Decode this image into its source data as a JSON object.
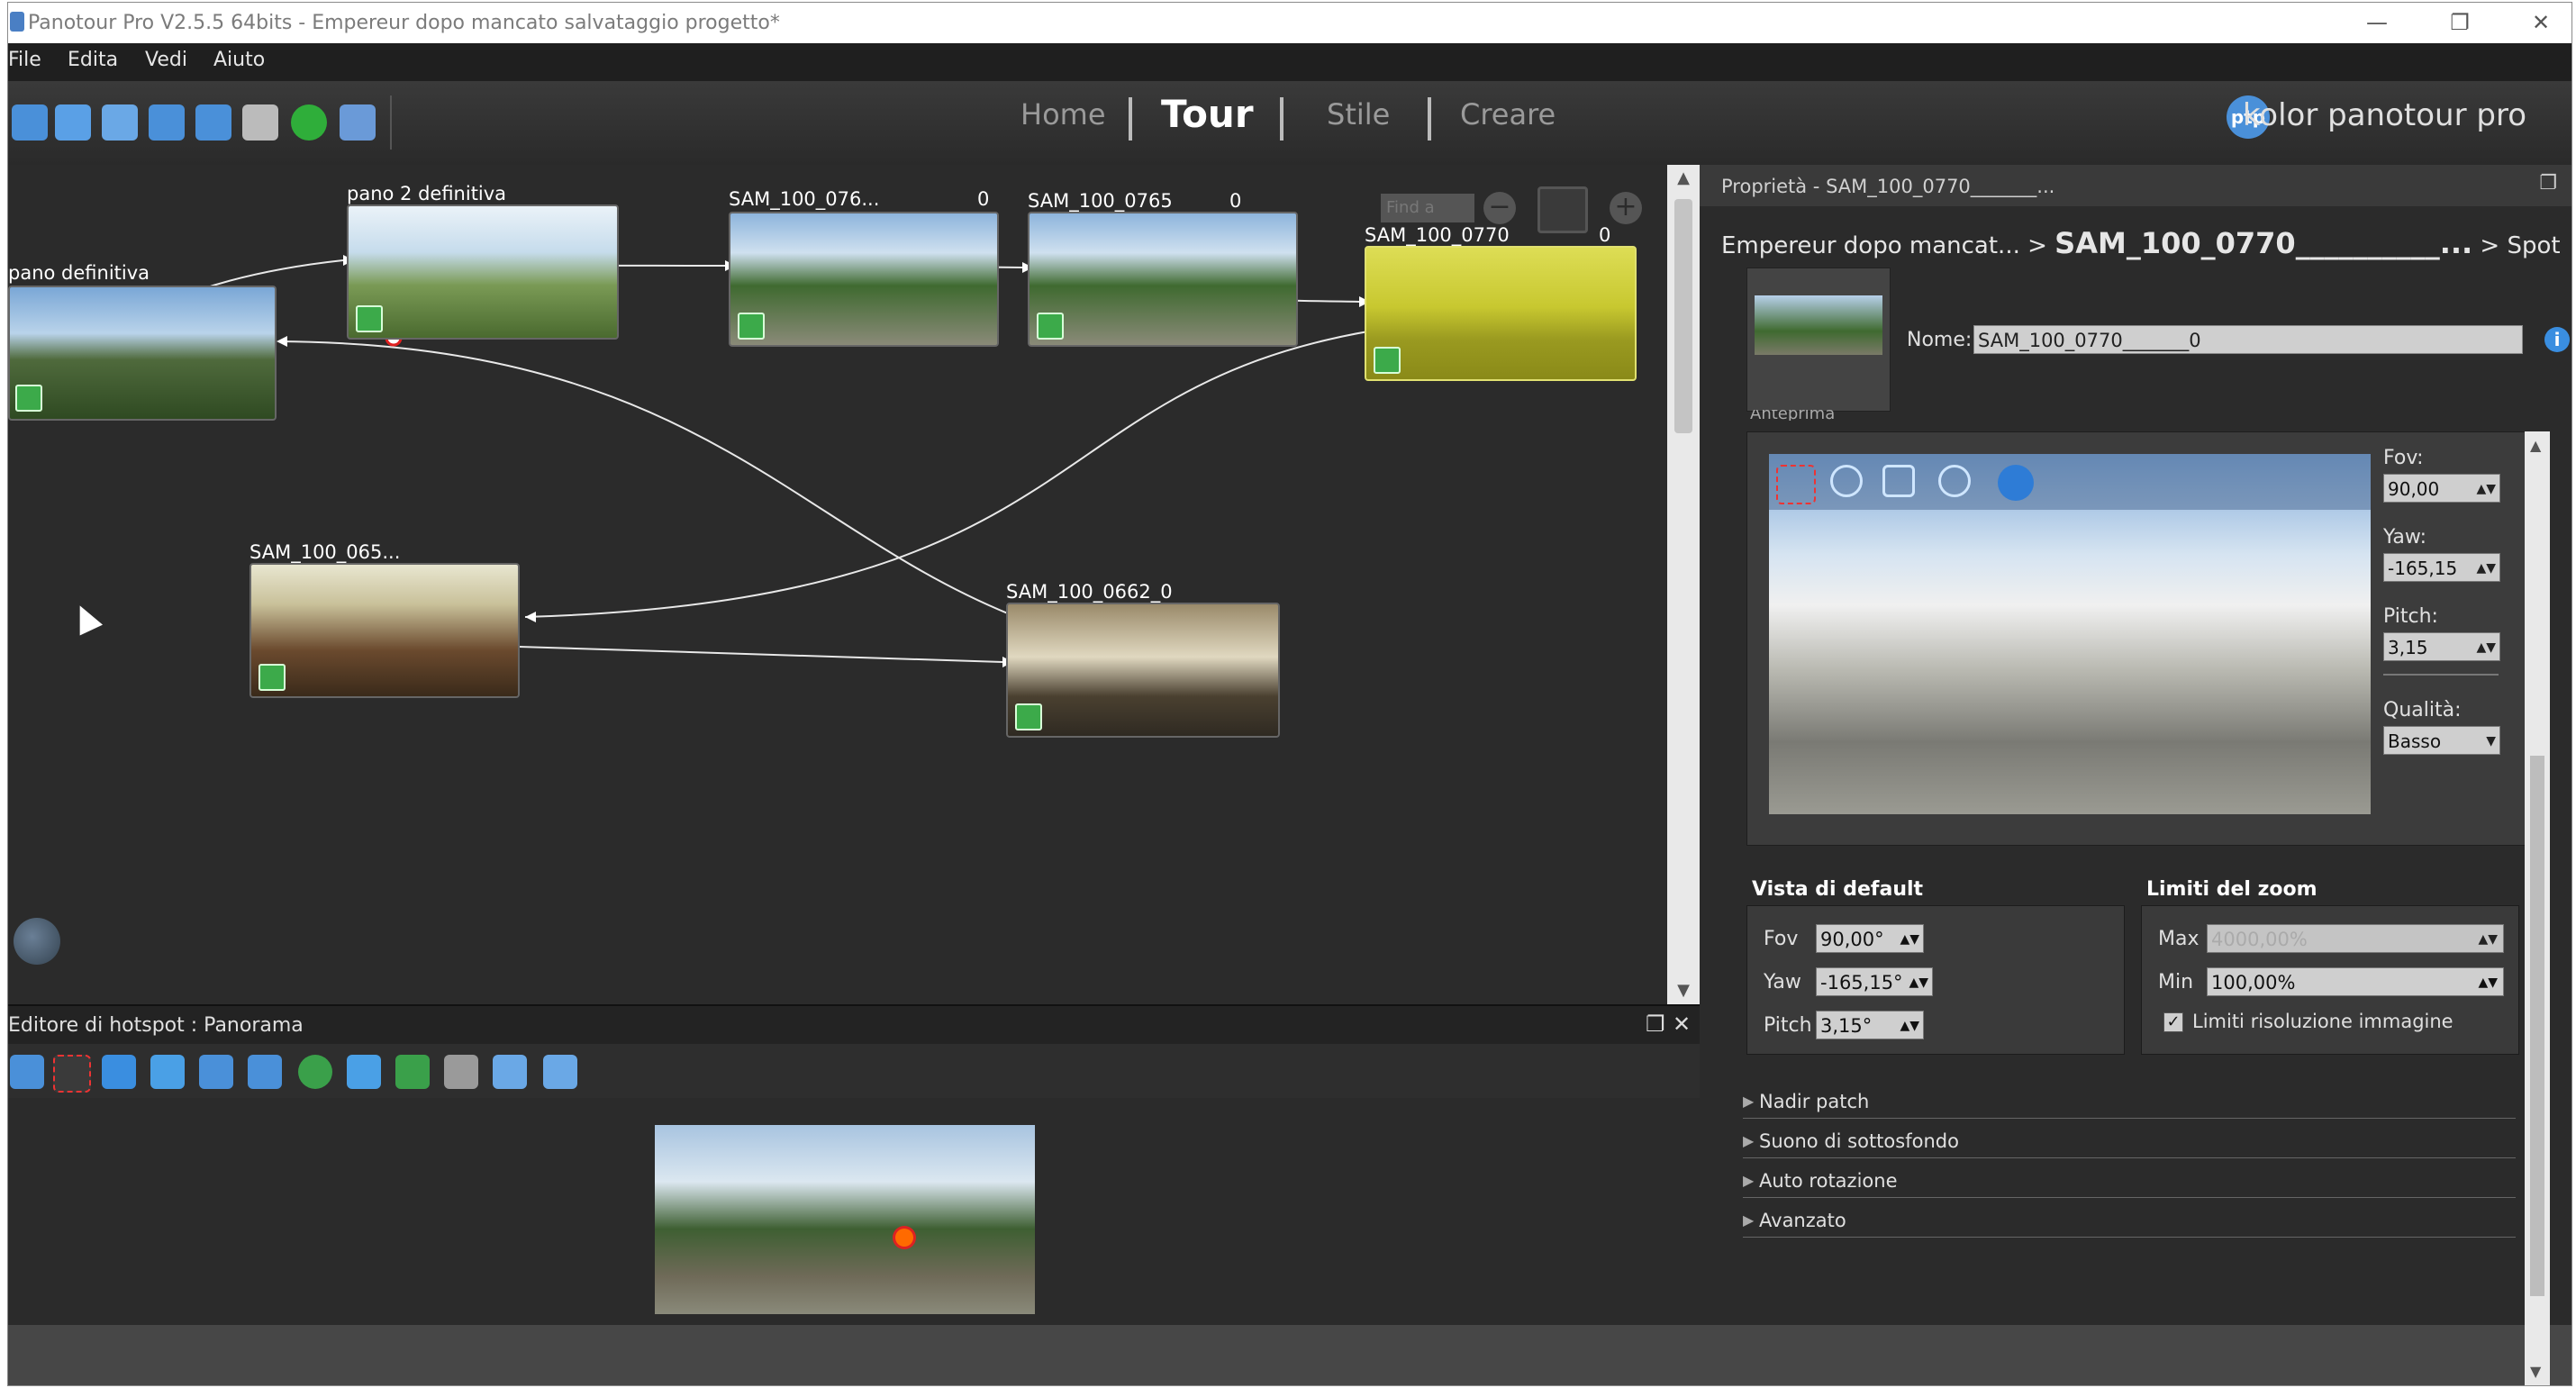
{
  "window": {
    "title": "Panotour Pro V2.5.5 64bits - Empereur dopo mancato salvataggio progetto*",
    "controls": [
      "—",
      "❐",
      "✕"
    ]
  },
  "menu": [
    "File",
    "Edita",
    "Vedi",
    "Aiuto"
  ],
  "toolbar": {
    "icons": [
      "search-icon",
      "save-icon",
      "add-panorama-icon",
      "undo-icon",
      "redo-icon",
      "settings-gear-icon",
      "play-icon",
      "folder-icon"
    ],
    "colors": [
      "#4a90d9",
      "#5aa0e6",
      "#6aa8e6",
      "#4a90d9",
      "#4a90d9",
      "#bbbbbb",
      "#2fae3a",
      "#6a9ad8"
    ],
    "nav": [
      {
        "label": "Home",
        "active": false
      },
      {
        "label": "Tour",
        "active": true
      },
      {
        "label": "Stile",
        "active": false
      },
      {
        "label": "Creare",
        "active": false
      }
    ],
    "brand": "kolor panotour pro",
    "brand_logo": "ptp"
  },
  "canvas": {
    "find_placeholder": "Find a",
    "nodes": [
      {
        "label": "pano definitiva",
        "count": "",
        "selected": false
      },
      {
        "label": "pano 2 definitiva",
        "count": "",
        "selected": false
      },
      {
        "label": "SAM_100_076...",
        "count": "0",
        "selected": false
      },
      {
        "label": "SAM_100_0765",
        "count": "0",
        "selected": false
      },
      {
        "label": "SAM_100_0770",
        "count": "0",
        "selected": true
      },
      {
        "label": "SAM_100_065...",
        "count": "",
        "selected": false
      },
      {
        "label": "SAM_100_0662_0",
        "count": "",
        "selected": false
      }
    ]
  },
  "hotspot_editor": {
    "title": "Editore di hotspot : Panorama",
    "controls": [
      "❐",
      "✕"
    ],
    "tools": [
      "move-icon",
      "select-rect-icon",
      "add-arrow-icon",
      "add-image-icon",
      "add-video-icon",
      "add-text-icon",
      "add-point-icon",
      "add-star-icon",
      "add-polygon-icon",
      "add-frame-icon",
      "add-panorama-icon",
      "add-panorama-link-icon"
    ]
  },
  "properties": {
    "header": "Proprietà - SAM_100_0770_______...",
    "breadcrumb": {
      "parent": "Empereur dopo mancat... >",
      "current": "SAM_100_0770__________...",
      "child": "> Spot"
    },
    "nome_label": "Nome:",
    "nome_value": "SAM_100_0770_______0",
    "preview_label": "Anteprima",
    "preview_tools": [
      "select-rect-icon",
      "zoom-out-icon",
      "fit-icon",
      "zoom-in-icon",
      "compass-icon"
    ],
    "fov_label": "Fov:",
    "fov": "90,00",
    "yaw_label": "Yaw:",
    "yaw": "-165,15",
    "pitch_label": "Pitch:",
    "pitch": "3,15",
    "quality_label": "Qualità:",
    "quality": "Basso",
    "default_view": {
      "title": "Vista di default",
      "fov_label": "Fov",
      "fov": "90,00°",
      "yaw_label": "Yaw",
      "yaw": "-165,15°",
      "pitch_label": "Pitch",
      "pitch": "3,15°"
    },
    "zoom_limits": {
      "title": "Limiti del zoom",
      "max_label": "Max",
      "max": "4000,00%",
      "min_label": "Min",
      "min": "100,00%",
      "image_limits_label": "Limiti risoluzione immagine",
      "image_limits_checked": true
    },
    "sections": [
      "Nadir patch",
      "Suono di sottosfondo",
      "Auto rotazione",
      "Avanzato"
    ]
  }
}
